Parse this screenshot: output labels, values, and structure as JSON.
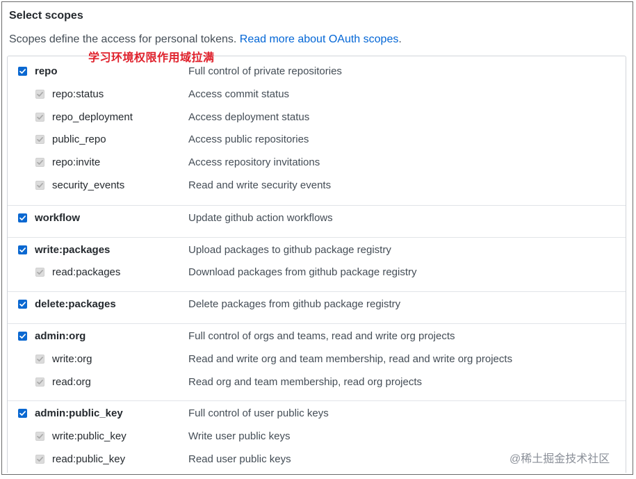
{
  "header": {
    "title": "Select scopes",
    "description": "Scopes define the access for personal tokens.",
    "link_text": "Read more about OAuth scopes",
    "link_suffix": "."
  },
  "annotation": "学习环境权限作用域拉满",
  "groups": [
    {
      "scopes": [
        {
          "name": "repo",
          "description": "Full control of private repositories",
          "checked": true,
          "child": false
        },
        {
          "name": "repo:status",
          "description": "Access commit status",
          "checked": true,
          "child": true
        },
        {
          "name": "repo_deployment",
          "description": "Access deployment status",
          "checked": true,
          "child": true
        },
        {
          "name": "public_repo",
          "description": "Access public repositories",
          "checked": true,
          "child": true
        },
        {
          "name": "repo:invite",
          "description": "Access repository invitations",
          "checked": true,
          "child": true
        },
        {
          "name": "security_events",
          "description": "Read and write security events",
          "checked": true,
          "child": true
        }
      ]
    },
    {
      "scopes": [
        {
          "name": "workflow",
          "description": "Update github action workflows",
          "checked": true,
          "child": false
        }
      ]
    },
    {
      "scopes": [
        {
          "name": "write:packages",
          "description": "Upload packages to github package registry",
          "checked": true,
          "child": false
        },
        {
          "name": "read:packages",
          "description": "Download packages from github package registry",
          "checked": true,
          "child": true
        }
      ]
    },
    {
      "scopes": [
        {
          "name": "delete:packages",
          "description": "Delete packages from github package registry",
          "checked": true,
          "child": false
        }
      ]
    },
    {
      "scopes": [
        {
          "name": "admin:org",
          "description": "Full control of orgs and teams, read and write org projects",
          "checked": true,
          "child": false
        },
        {
          "name": "write:org",
          "description": "Read and write org and team membership, read and write org projects",
          "checked": true,
          "child": true
        },
        {
          "name": "read:org",
          "description": "Read org and team membership, read org projects",
          "checked": true,
          "child": true
        }
      ]
    },
    {
      "scopes": [
        {
          "name": "admin:public_key",
          "description": "Full control of user public keys",
          "checked": true,
          "child": false
        },
        {
          "name": "write:public_key",
          "description": "Write user public keys",
          "checked": true,
          "child": true
        },
        {
          "name": "read:public_key",
          "description": "Read user public keys",
          "checked": true,
          "child": true
        }
      ]
    }
  ],
  "watermark": "@稀土掘金技术社区",
  "colors": {
    "checkbox_checked": "#0a68d1",
    "checkbox_inherited": "#dcdcdc",
    "link": "#0366d6",
    "annotation": "#e0202b"
  },
  "icons": {
    "checked": "checkmark-icon"
  }
}
